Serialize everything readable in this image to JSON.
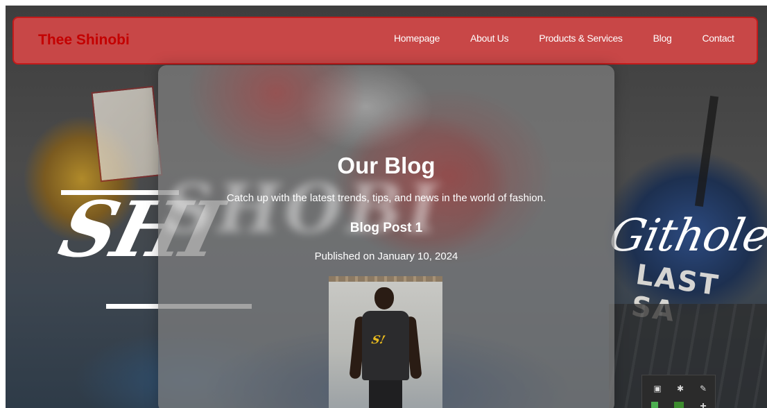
{
  "navbar": {
    "brand": "Thee Shinobi",
    "links": [
      "Homepage",
      "About Us",
      "Products & Services",
      "Blog",
      "Contact"
    ]
  },
  "blog": {
    "title": "Our Blog",
    "subtitle": "Catch up with the latest trends, tips, and news in the world of fashion.",
    "post": {
      "title": "Blog Post 1",
      "date": "Published on January 10, 2024"
    }
  },
  "background": {
    "script_left": "SHI",
    "script_right": "Githole",
    "sign_text": "LAST SA"
  },
  "colors": {
    "navbar_bg": "#de4848",
    "brand": "#c40000",
    "nav_border": "#c41a1a"
  },
  "icons": {
    "tray": [
      "screen-icon",
      "bluetooth-icon",
      "pen-icon",
      "app-icon",
      "app-icon",
      "add-icon"
    ]
  }
}
